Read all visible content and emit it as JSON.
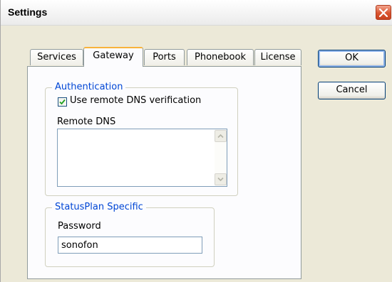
{
  "window": {
    "title": "Settings",
    "close_icon": "close-icon"
  },
  "tabs": [
    {
      "label": "Services",
      "active": false
    },
    {
      "label": "Gateway",
      "active": true
    },
    {
      "label": "Ports",
      "active": false
    },
    {
      "label": "Phonebook",
      "active": false
    },
    {
      "label": "License",
      "active": false
    }
  ],
  "authentication": {
    "title": "Authentication",
    "use_remote_dns_label": "Use remote DNS verification",
    "use_remote_dns_checked": true,
    "remote_dns_label": "Remote DNS",
    "remote_dns_value": ""
  },
  "statusplan": {
    "title": "StatusPlan Specific",
    "password_label": "Password",
    "password_value": "sonofon"
  },
  "buttons": {
    "ok": "OK",
    "cancel": "Cancel"
  },
  "colors": {
    "group_title": "#0046d5",
    "tab_highlight": "#f8b33b",
    "close_button": "#d9542f"
  }
}
